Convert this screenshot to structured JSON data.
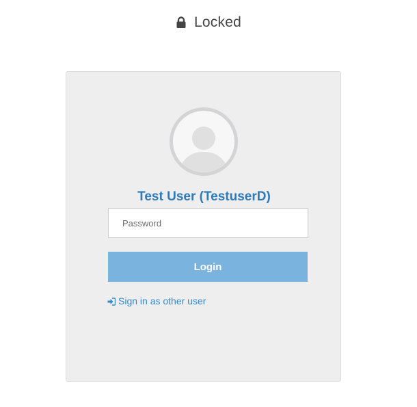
{
  "header": {
    "icon": "lock-icon",
    "title": "Locked"
  },
  "user": {
    "avatar_icon": "user-avatar-icon",
    "display_name": "Test User (TestuserD)"
  },
  "form": {
    "password_placeholder": "Password",
    "password_value": "",
    "login_label": "Login"
  },
  "links": {
    "sign_in_other_icon": "sign-in-icon",
    "sign_in_other_label": "Sign in as other user"
  },
  "colors": {
    "accent": "#2f7ab8",
    "link": "#2f8ad0",
    "button": "#7ab3de",
    "panel_bg": "#eeeeee"
  }
}
